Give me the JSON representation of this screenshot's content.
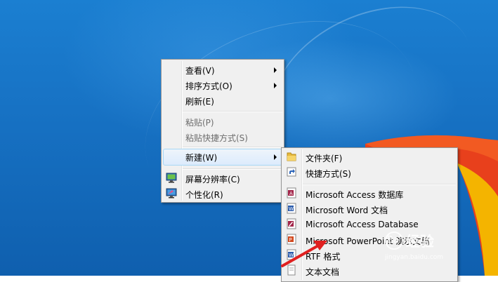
{
  "context_menu": {
    "items": [
      {
        "label": "查看(V)",
        "submenu": true,
        "disabled": false
      },
      {
        "label": "排序方式(O)",
        "submenu": true,
        "disabled": false
      },
      {
        "label": "刷新(E)",
        "submenu": false,
        "disabled": false
      },
      {
        "label": "粘贴(P)",
        "submenu": false,
        "disabled": true
      },
      {
        "label": "粘贴快捷方式(S)",
        "submenu": false,
        "disabled": true
      },
      {
        "label": "新建(W)",
        "submenu": true,
        "disabled": false,
        "highlighted": true
      },
      {
        "label": "屏幕分辨率(C)",
        "icon": "monitor-icon"
      },
      {
        "label": "个性化(R)",
        "icon": "personalize-icon"
      }
    ]
  },
  "new_submenu": {
    "items": [
      {
        "label": "文件夹(F)",
        "icon": "folder-icon"
      },
      {
        "label": "快捷方式(S)",
        "icon": "shortcut-icon"
      },
      {
        "label": "Microsoft Access 数据库",
        "icon": "access-icon"
      },
      {
        "label": "Microsoft Word 文档",
        "icon": "word-icon"
      },
      {
        "label": "Microsoft Access Database",
        "icon": "access-icon"
      },
      {
        "label": "Microsoft PowerPoint 演示文稿",
        "icon": "powerpoint-icon"
      },
      {
        "label": "RTF 格式",
        "icon": "rtf-icon"
      },
      {
        "label": "文本文档",
        "icon": "text-document-icon"
      }
    ]
  },
  "watermark": {
    "brand": "经验",
    "site": "jingyan.baidu.com"
  },
  "colors": {
    "desktop": "#1772c4",
    "arrow": "#e02020",
    "highlight": "#dcebfc"
  }
}
